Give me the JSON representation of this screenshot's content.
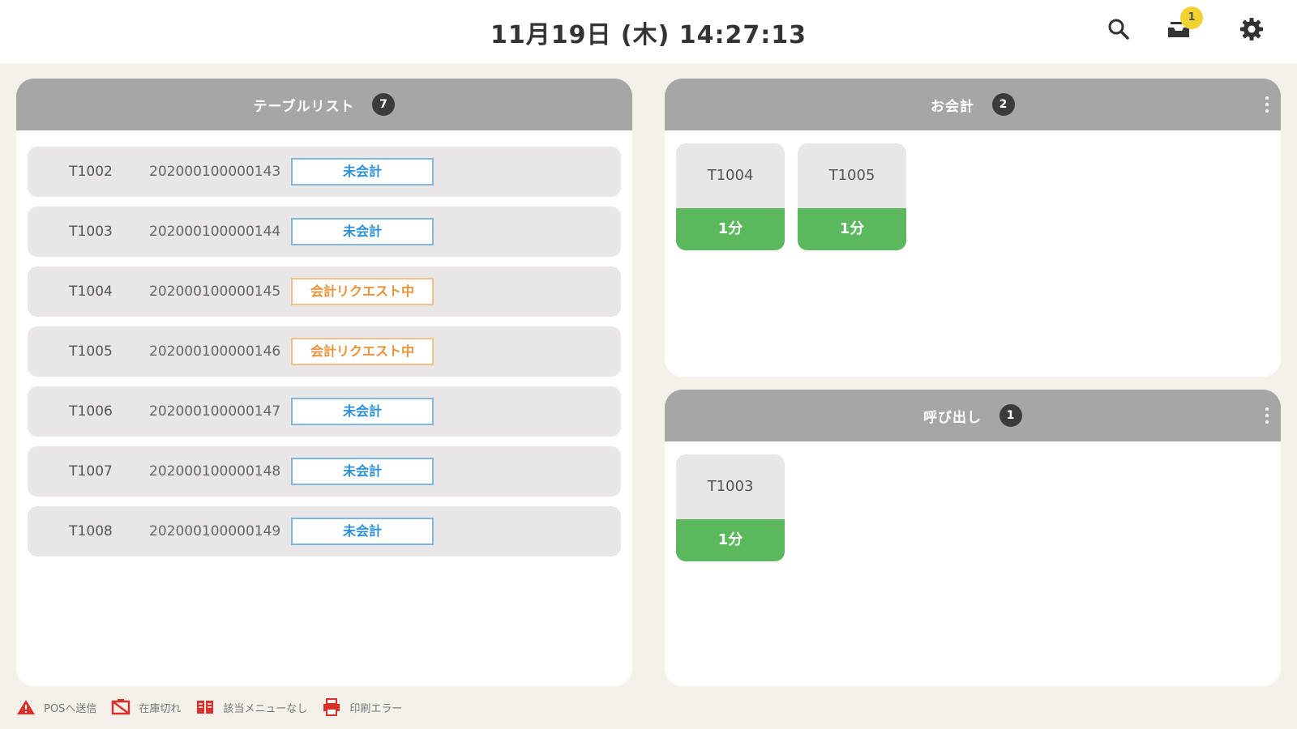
{
  "header": {
    "datetime": "11月19日 (木) 14:27:13",
    "notification_count": "1"
  },
  "icons": {
    "search": "search-icon",
    "notifications": "inbox-tray-icon",
    "settings": "gear-icon"
  },
  "tables_panel": {
    "title": "テーブルリスト",
    "count": "7",
    "rows": [
      {
        "table": "T1002",
        "order": "202000100000143",
        "status": "未会計",
        "status_type": "unpaid"
      },
      {
        "table": "T1003",
        "order": "202000100000144",
        "status": "未会計",
        "status_type": "unpaid"
      },
      {
        "table": "T1004",
        "order": "202000100000145",
        "status": "会計リクエスト中",
        "status_type": "request"
      },
      {
        "table": "T1005",
        "order": "202000100000146",
        "status": "会計リクエスト中",
        "status_type": "request"
      },
      {
        "table": "T1006",
        "order": "202000100000147",
        "status": "未会計",
        "status_type": "unpaid"
      },
      {
        "table": "T1007",
        "order": "202000100000148",
        "status": "未会計",
        "status_type": "unpaid"
      },
      {
        "table": "T1008",
        "order": "202000100000149",
        "status": "未会計",
        "status_type": "unpaid"
      }
    ]
  },
  "checkout_panel": {
    "title": "お会計",
    "count": "2",
    "cards": [
      {
        "table": "T1004",
        "elapsed": "1分"
      },
      {
        "table": "T1005",
        "elapsed": "1分"
      }
    ]
  },
  "call_panel": {
    "title": "呼び出し",
    "count": "1",
    "cards": [
      {
        "table": "T1003",
        "elapsed": "1分"
      }
    ]
  },
  "legend": [
    {
      "label": "POSへ送信",
      "icon": "warning-icon"
    },
    {
      "label": "在庫切れ",
      "icon": "out-of-stock-icon"
    },
    {
      "label": "該当メニューなし",
      "icon": "no-menu-icon"
    },
    {
      "label": "印刷エラー",
      "icon": "printer-error-icon"
    }
  ],
  "colors": {
    "unpaid": "#2c8fd6",
    "request": "#e8933a",
    "elapsed_green": "#5cb85c",
    "header_gray": "#a6a6a6",
    "error_red": "#d9302c",
    "badge_yellow": "#f2d231"
  }
}
